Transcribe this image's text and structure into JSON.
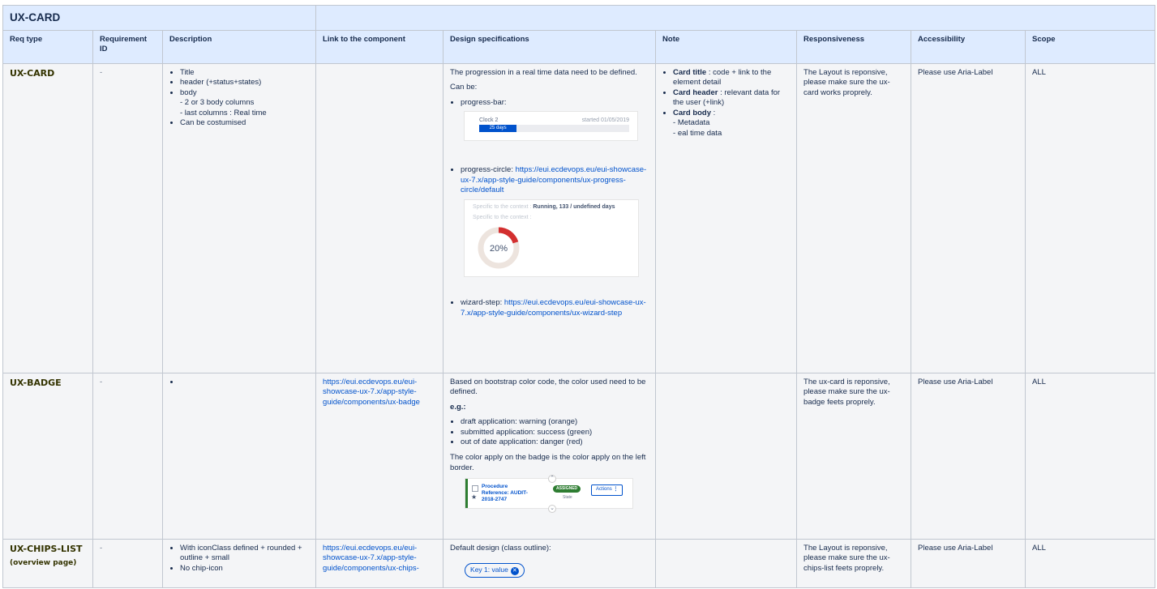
{
  "section_title": "UX-CARD",
  "headers": {
    "req_type": "Req type",
    "req_id": "Requirement ID",
    "description": "Description",
    "link": "Link to the component",
    "design": "Design specifications",
    "note": "Note",
    "responsive": "Responsiveness",
    "accessibility": "Accessibility",
    "scope": "Scope"
  },
  "rows": [
    {
      "req_type": "UX-CARD",
      "req_id": "-",
      "description": {
        "items": [
          "Title",
          "header (+status+states)",
          "body",
          "Can be costumised"
        ],
        "body_sub": [
          "- 2 or 3 body columns",
          "- last columns : Real time"
        ]
      },
      "design": {
        "intro": "The progression in a real time data need to be defined.",
        "can_be": "Can be:",
        "progress_bar_label": "progress-bar:",
        "progress_bar_snip": {
          "clock": "Clock 2",
          "started": "started 01/05/2019",
          "fill_text": "25 days",
          "fill_fraction": 0.25
        },
        "progress_circle_label": "progress-circle: ",
        "progress_circle_link": "https://eui.ecdevops.eu/eui-showcase-ux-7.x/app-style-guide/components/ux-progress-circle/default",
        "progress_circle_snip": {
          "line1_prefix": "Specific to the context : ",
          "line1_value": "Running, 133 / undefined days",
          "line2": "Specific to the context :",
          "percent_label": "20%",
          "percent": 20
        },
        "wizard_label": "wizard-step: ",
        "wizard_link": "https://eui.ecdevops.eu/eui-showcase-ux-7.x/app-style-guide/components/ux-wizard-step"
      },
      "note": {
        "card_title_bold": "Card title",
        "card_title_rest": " : code + link to the element detail",
        "card_header_bold": "Card header",
        "card_header_rest": " : relevant data for the user (+link)",
        "card_body_bold": "Card body",
        "card_body_rest": " :",
        "card_body_sub1": "- Metadata",
        "card_body_sub2": "- eal time data"
      },
      "responsive": "The Layout is reponsive, please make sure the ux-card works proprely.",
      "accessibility": "Please use Aria-Label",
      "scope": "ALL"
    },
    {
      "req_type": "UX-BADGE",
      "req_id": "-",
      "link": "https://eui.ecdevops.eu/eui-showcase-ux-7.x/app-style-guide/components/ux-badge",
      "design": {
        "intro": "Based on bootstrap color code, the color used need to be defined.",
        "eg": "e.g.:",
        "items": [
          "draft application: warning (orange)",
          "submitted application: success (green)",
          "out of date application: danger (red)"
        ],
        "outro": "The color apply on the badge is the color apply on the left border.",
        "badge_snip": {
          "ref": "Procedure Reference: AUDIT-2018-2747",
          "pill": "ASSIGNED",
          "state": "State",
          "actions": "Actions"
        }
      },
      "responsive": "The ux-card is reponsive, please make sure the ux-badge feets proprely.",
      "accessibility": "Please use Aria-Label",
      "scope": "ALL"
    },
    {
      "req_type": "UX-CHIPS-LIST",
      "req_type_sub": "(overview page)",
      "req_id": "-",
      "description_items": [
        "With iconClass defined + rounded + outline + small",
        "No chip-icon"
      ],
      "link": "https://eui.ecdevops.eu/eui-showcase-ux-7.x/app-style-guide/components/ux-chips-",
      "design": {
        "intro": "Default design (class outline):",
        "chip": "Key 1: value"
      },
      "responsive": "The Layout is reponsive, please make sure the ux-chips-list feets proprely.",
      "accessibility": "Please use Aria-Label",
      "scope": "ALL"
    }
  ]
}
